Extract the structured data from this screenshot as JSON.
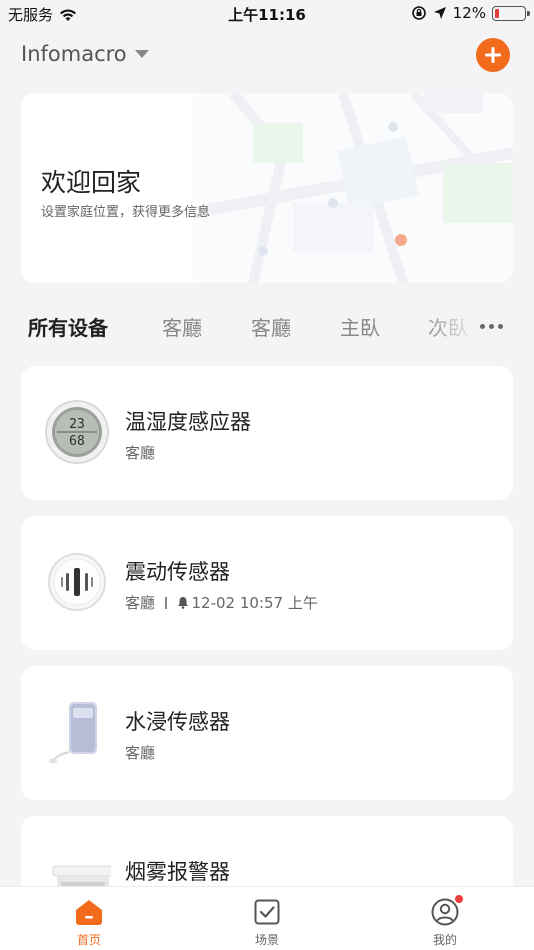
{
  "status_bar": {
    "carrier": "无服务",
    "time": "上午11:16",
    "battery": "12%"
  },
  "header": {
    "home_name": "Infomacro"
  },
  "welcome": {
    "title": "欢迎回家",
    "subtitle": "设置家庭位置，获得更多信息"
  },
  "tabs": [
    {
      "label": "所有设备",
      "active": true
    },
    {
      "label": "客廳",
      "active": false
    },
    {
      "label": "客廳",
      "active": false
    },
    {
      "label": "主臥",
      "active": false
    },
    {
      "label": "次臥",
      "active": false
    }
  ],
  "devices": [
    {
      "name": "温湿度感应器",
      "room": "客廳",
      "readings": [
        "23",
        "68"
      ]
    },
    {
      "name": "震动传感器",
      "room": "客廳",
      "event_time": "12-02 10:57 上午"
    },
    {
      "name": "水浸传感器",
      "room": "客廳"
    },
    {
      "name": "烟雾报警器",
      "room": ""
    }
  ],
  "bottom_nav": [
    {
      "label": "首页",
      "icon": "home-icon",
      "active": true
    },
    {
      "label": "场景",
      "icon": "scene-check-icon",
      "active": false
    },
    {
      "label": "我的",
      "icon": "profile-icon",
      "active": false,
      "badge": true
    }
  ],
  "colors": {
    "accent": "#f26b1d",
    "background": "#f4f4f6",
    "card": "#ffffff",
    "badge": "#f23b3b"
  }
}
